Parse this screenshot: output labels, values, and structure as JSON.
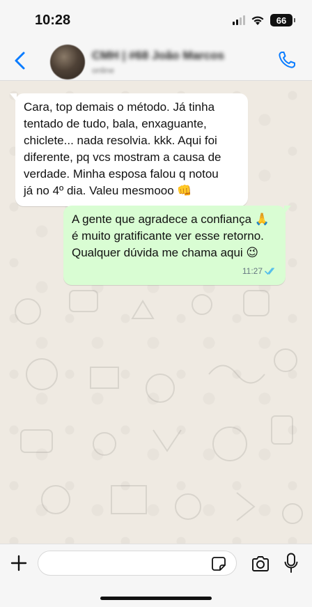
{
  "status_bar": {
    "time": "10:28",
    "battery": "66"
  },
  "header": {
    "contact_name": "CMH | #68 João Marcos",
    "contact_status": "online"
  },
  "messages": {
    "incoming": {
      "lines": [
        "Cara, top demais o método. Já tinha",
        "tentado de tudo, bala, enxaguante,",
        "chiclete... nada resolvia. kkk. Aqui foi",
        "diferente, pq vcs mostram a causa de",
        "verdade. Minha esposa falou q notou",
        "já no 4º dia. Valeu mesmooo 👊"
      ]
    },
    "outgoing": {
      "lines": [
        "A gente que agradece a confiança 🙏",
        "é muito gratificante ver esse retorno.",
        "Qualquer dúvida me chama aqui 😉"
      ],
      "time": "11:27"
    }
  },
  "input": {
    "placeholder": ""
  },
  "colors": {
    "accent": "#0a7cff",
    "incoming_bubble": "#ffffff",
    "outgoing_bubble": "#d9fdd3",
    "chat_background": "#efeae2",
    "read_ticks": "#53bdeb"
  }
}
